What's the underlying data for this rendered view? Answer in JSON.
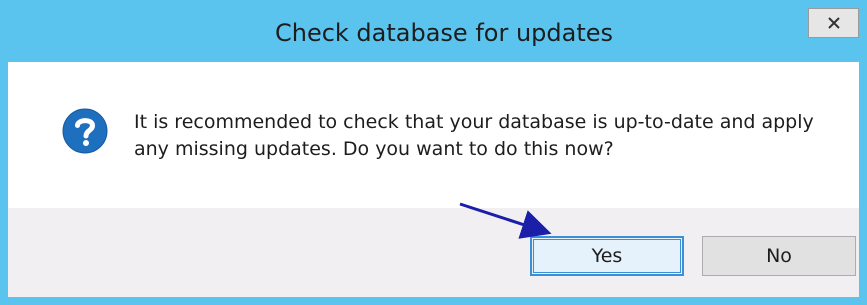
{
  "dialog": {
    "title": "Check database for updates",
    "close_label": "x",
    "message": "It is recommended to check that your database is up-to-date and apply\nany missing updates. Do you want to do this now?",
    "icon": "question-icon",
    "buttons": {
      "yes_label": "Yes",
      "no_label": "No"
    }
  },
  "colors": {
    "titlebar": "#5bc4ee",
    "footer": "#f2eff3",
    "icon": "#1f6fbf",
    "arrow": "#1a1ea8",
    "focus_border": "#3c8fd6"
  }
}
